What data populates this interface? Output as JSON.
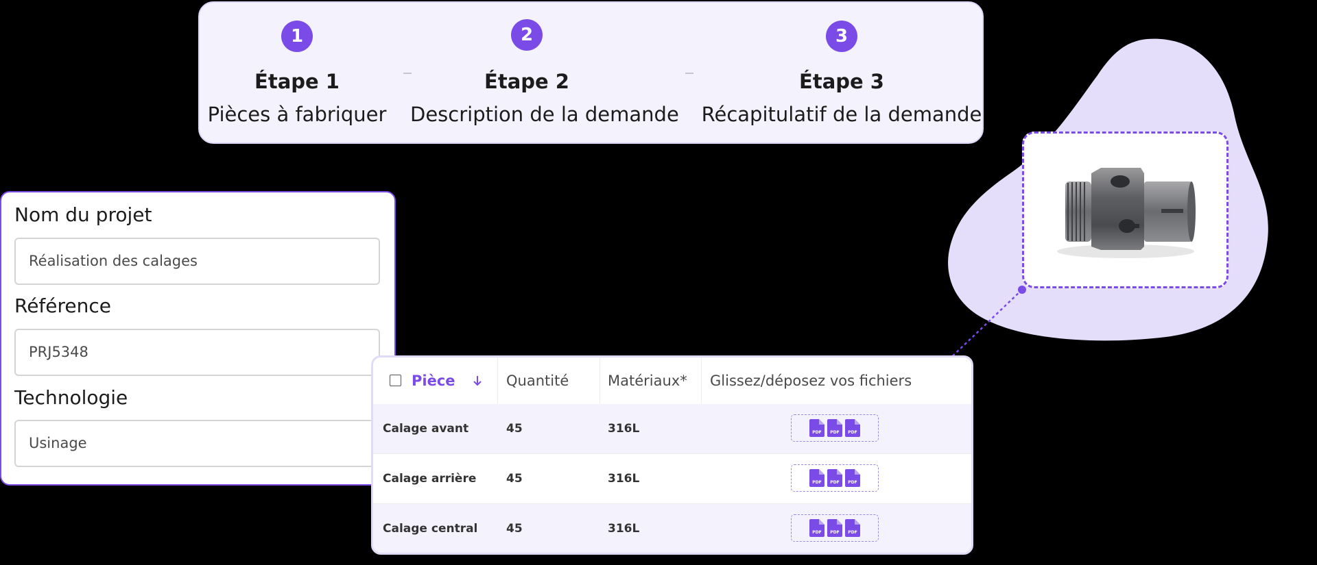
{
  "stepper": {
    "steps": [
      {
        "number": "1",
        "title": "Étape 1",
        "description": "Pièces à fabriquer"
      },
      {
        "number": "2",
        "title": "Étape 2",
        "description": "Description de la demande"
      },
      {
        "number": "3",
        "title": "Étape 3",
        "description": "Récapitulatif de la demande"
      }
    ]
  },
  "form": {
    "project_name": {
      "label": "Nom du projet",
      "value": "Réalisation des calages"
    },
    "reference": {
      "label": "Référence",
      "value": "PRJ5348"
    },
    "technology": {
      "label": "Technologie",
      "value": "Usinage"
    }
  },
  "table": {
    "headers": {
      "piece": "Pièce",
      "quantity": "Quantité",
      "material": "Matériaux*",
      "files": "Glissez/déposez vos fichiers"
    },
    "rows": [
      {
        "piece": "Calage avant",
        "quantity": "45",
        "material": "316L"
      },
      {
        "piece": "Calage arrière",
        "quantity": "45",
        "material": "316L"
      },
      {
        "piece": "Calage central",
        "quantity": "45",
        "material": "316L"
      }
    ],
    "file_icon_label": "PDF"
  },
  "colors": {
    "accent": "#7b4be8",
    "accent_light": "#e4defa",
    "panel_bg": "#f4f2fc",
    "background": "#000000"
  }
}
